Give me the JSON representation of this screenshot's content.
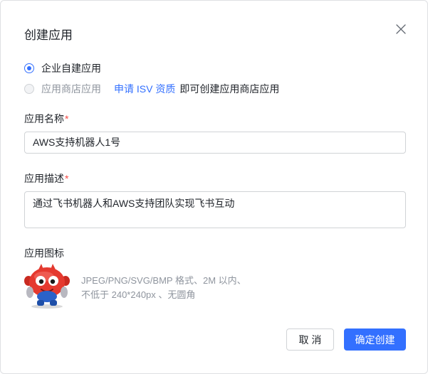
{
  "dialog": {
    "title": "创建应用",
    "close_icon": "close-icon"
  },
  "app_type": {
    "options": [
      {
        "label": "企业自建应用",
        "selected": true,
        "disabled": false
      },
      {
        "label": "应用商店应用",
        "selected": false,
        "disabled": true
      }
    ],
    "isv_link": "申请 ISV 资质",
    "isv_suffix": "即可创建应用商店应用"
  },
  "app_name": {
    "label": "应用名称",
    "required_mark": "*",
    "value": "AWS支持机器人1号"
  },
  "app_desc": {
    "label": "应用描述",
    "required_mark": "*",
    "value": "通过飞书机器人和AWS支持团队实现飞书互动"
  },
  "app_icon": {
    "label": "应用图标",
    "icon": "robot-mascot-icon",
    "hint_line1": "JPEG/PNG/SVG/BMP 格式、2M 以内、",
    "hint_line2": "不低于 240*240px 、无圆角"
  },
  "buttons": {
    "cancel": "取 消",
    "confirm": "确定创建"
  },
  "colors": {
    "primary": "#3370ff",
    "required": "#f54a45",
    "muted": "#8f959e"
  }
}
